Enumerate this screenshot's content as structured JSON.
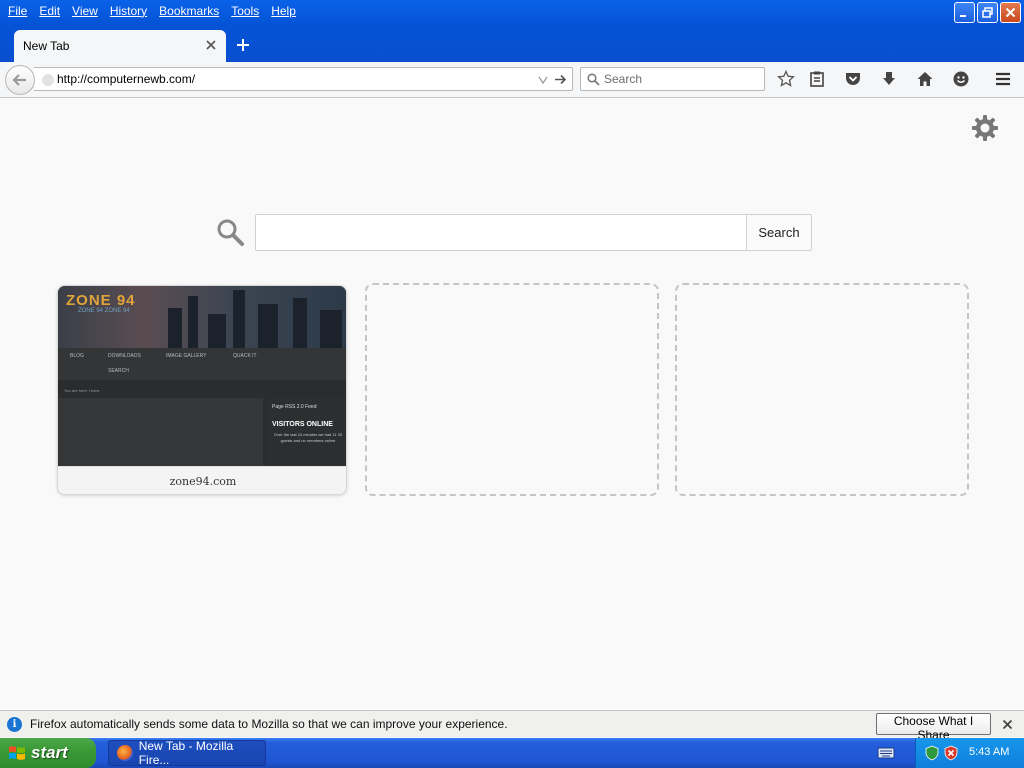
{
  "menubar": {
    "items": [
      "File",
      "Edit",
      "View",
      "History",
      "Bookmarks",
      "Tools",
      "Help"
    ]
  },
  "tabs": [
    {
      "label": "New Tab",
      "active": true
    }
  ],
  "navbar": {
    "url": "http://computernewb.com/",
    "search_placeholder": "Search"
  },
  "content": {
    "search_button": "Search",
    "tiles": [
      {
        "caption": "zone94.com",
        "thumbnail": {
          "logo": "ZONE 94",
          "logo_sub": "ZONE 94 ZONE 94",
          "nav": [
            "BLOG",
            "DOWNLOADS",
            "IMAGE GALLERY",
            "QUACK IT",
            "SEARCH"
          ],
          "crumb": "You are here: Home",
          "rss": "Page RSS 2.0 Feed",
          "visitors_title": "VISITORS ONLINE",
          "visitors_text": "Over the last 10 minutes we had 11 33 guests and no members online"
        }
      },
      {
        "caption": ""
      },
      {
        "caption": ""
      }
    ]
  },
  "notification": {
    "text": "Firefox automatically sends some data to Mozilla so that we can improve your experience.",
    "button": "Choose What I Share"
  },
  "taskbar": {
    "start_label": "start",
    "task_label": "New Tab - Mozilla Fire...",
    "clock": "5:43 AM"
  },
  "colors": {
    "xp_blue": "#0553d6",
    "start_green": "#3a9a36",
    "page_bg": "#f9f9fa",
    "info_blue": "#1a75d2"
  }
}
